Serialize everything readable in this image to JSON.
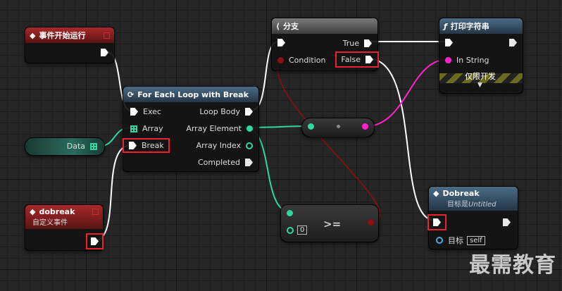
{
  "nodes": {
    "begin_play": {
      "title": "事件开始运行"
    },
    "for_each": {
      "title": "For Each Loop with Break",
      "exec": "Exec",
      "array": "Array",
      "break": "Break",
      "loop_body": "Loop Body",
      "array_element": "Array Element",
      "array_index": "Array Index",
      "completed": "Completed"
    },
    "data_var": {
      "label": "Data"
    },
    "branch": {
      "title": "分支",
      "condition": "Condition",
      "true": "True",
      "false": "False"
    },
    "print": {
      "title": "打印字符串",
      "in_string": "In String",
      "dev_only": "仅限开发"
    },
    "compare": {
      "op": ">=",
      "value": "0"
    },
    "custom_event": {
      "title": "dobreak",
      "subtitle": "自定义事件"
    },
    "dobreak_call": {
      "title": "Dobreak",
      "subtitle_prefix": "目标是",
      "subtitle_target": "Untitled",
      "target_label": "目标",
      "target_value": "self"
    }
  },
  "watermark": "最需教育",
  "colors": {
    "event_header": "#8b1a1a",
    "function_header": "#2f4f66",
    "branch_header": "#5a5a5a",
    "highlight": "#e8232c",
    "exec_wire": "#ffffff",
    "int_wire": "#2fd7a1",
    "string_wire": "#ff22cc",
    "bool_wire": "#8d0f0f"
  }
}
